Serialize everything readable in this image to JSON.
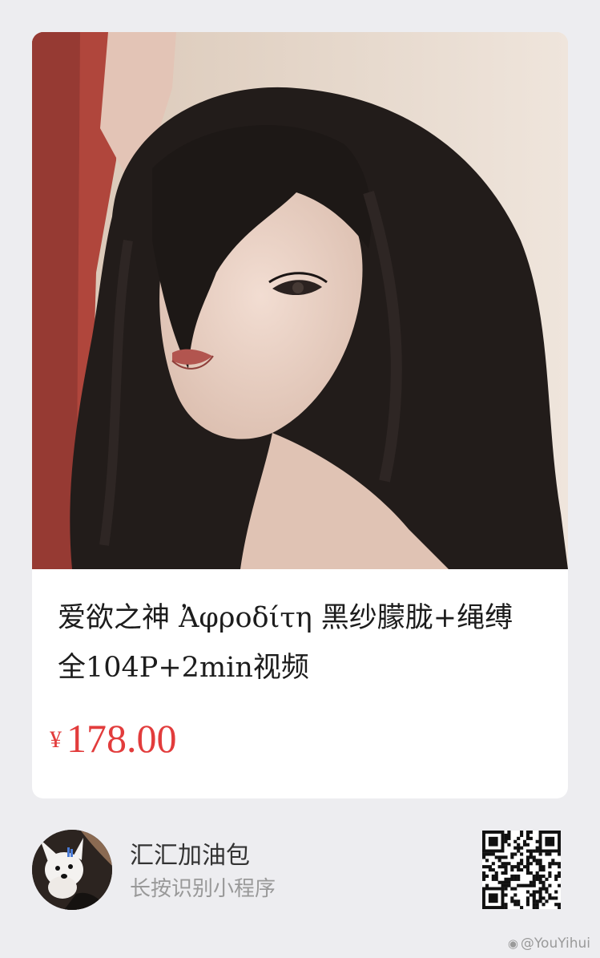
{
  "product": {
    "title": "爱欲之神 Ἀφροδίτη 黑纱朦胧+绳缚 全104P+2min视频",
    "currency_symbol": "¥",
    "price": "178.00",
    "photo_icon": "portrait-photo"
  },
  "shop": {
    "name": "汇汇加油包",
    "hint": "长按识别小程序",
    "avatar_icon": "dog-avatar",
    "qr_icon": "mini-program-qr-code"
  },
  "watermark": {
    "icon": "weibo-icon",
    "text": "@YouYihui"
  },
  "colors": {
    "background": "#ededf0",
    "card": "#ffffff",
    "price": "#e23c3c",
    "title": "#1c1c1c",
    "hint": "#999999"
  }
}
